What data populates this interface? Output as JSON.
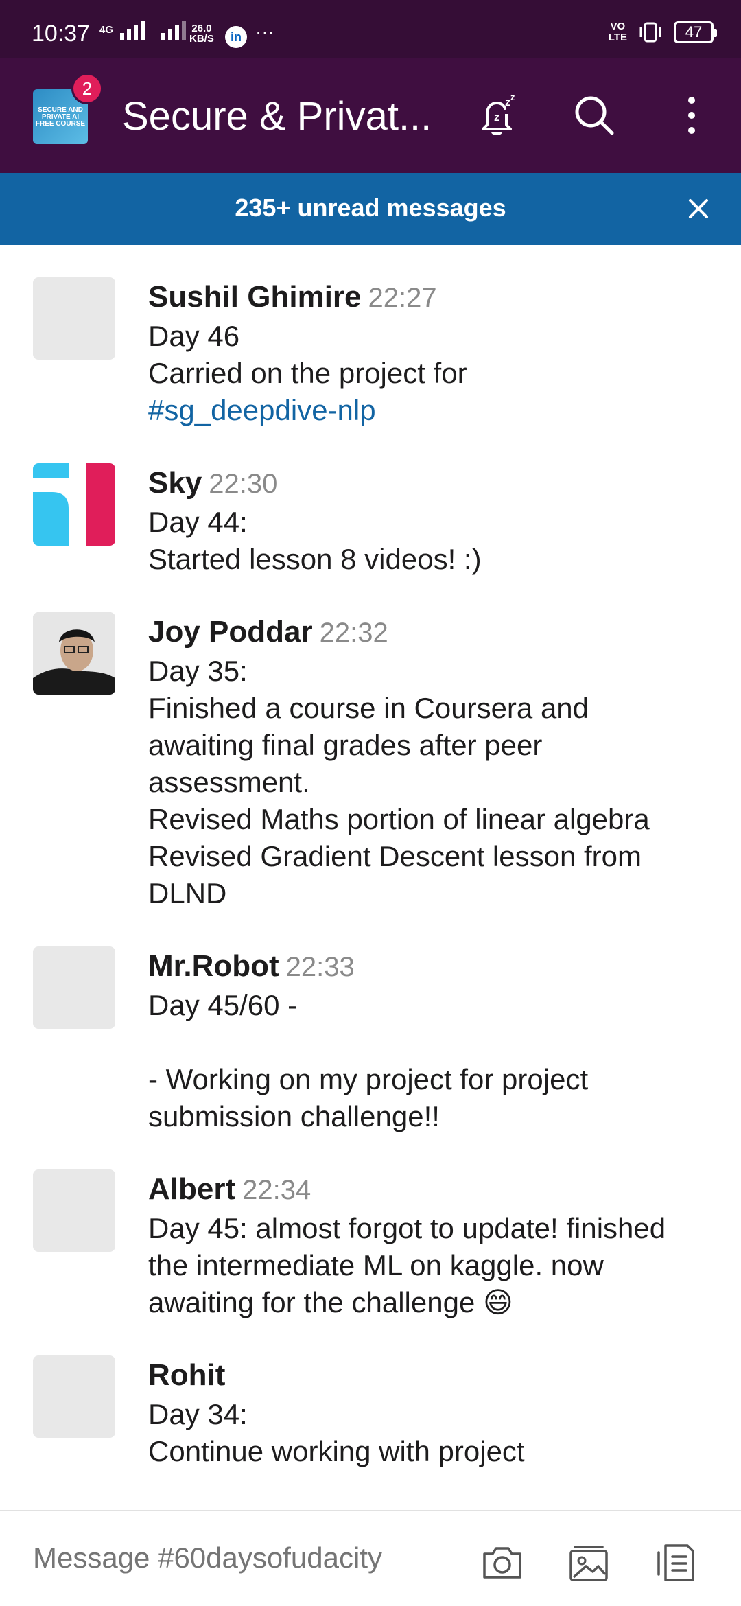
{
  "status_bar": {
    "time": "10:37",
    "network": "4G",
    "speed_top": "26.0",
    "speed_unit": "KB/S",
    "linkedin": "in",
    "more": "···",
    "volte_top": "VO",
    "volte_bottom": "LTE",
    "battery": "47"
  },
  "header": {
    "channel_title": "Secure & Privat...",
    "avatar_text": "SECURE AND PRIVATE AI FREE COURSE",
    "badge_count": "2"
  },
  "unread_banner": {
    "text": "235+ unread messages"
  },
  "messages": [
    {
      "author": "Sushil Ghimire",
      "time": "22:27",
      "lines": [
        "Day 46",
        "Carried on the project for"
      ],
      "link": "#sg_deepdive-nlp"
    },
    {
      "author": "Sky",
      "time": "22:30",
      "lines": [
        "Day 44:",
        "Started lesson 8 videos! :)"
      ]
    },
    {
      "author": "Joy Poddar",
      "time": "22:32",
      "lines": [
        "Day 35:",
        "Finished a course in Coursera and",
        "awaiting final grades after peer",
        "assessment.",
        "Revised Maths portion of linear algebra",
        "Revised Gradient Descent lesson from",
        "DLND"
      ]
    },
    {
      "author": "Mr.Robot",
      "time": "22:33",
      "lines": [
        "Day 45/60 -",
        "",
        "- Working on my project for project",
        "submission challenge!!"
      ]
    },
    {
      "author": "Albert",
      "time": "22:34",
      "lines": [
        "Day 45: almost forgot to update! finished",
        "the intermediate ML on kaggle. now",
        "awaiting for the challenge 😄"
      ]
    },
    {
      "author": "Rohit",
      "time": "",
      "lines": [
        "Day 34:",
        "Continue working with project"
      ]
    }
  ],
  "composer": {
    "placeholder": "Message #60daysofudacity"
  },
  "icons": {
    "snooze": "bell-snooze-icon",
    "search": "search-icon",
    "more": "more-vertical-icon",
    "close": "close-icon",
    "camera": "camera-icon",
    "gallery": "gallery-icon",
    "files": "files-icon"
  },
  "colors": {
    "status_bar": "#350d36",
    "app_bar": "#3f0e40",
    "unread_banner": "#1264a3",
    "badge": "#e01e5a",
    "link": "#1264a3"
  }
}
